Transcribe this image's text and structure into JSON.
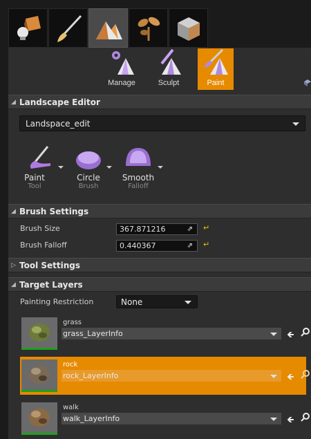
{
  "mode_tabs": [
    {
      "icon": "place-mode-icon"
    },
    {
      "icon": "paint-brush-mode-icon"
    },
    {
      "icon": "landscape-mode-icon"
    },
    {
      "icon": "foliage-mode-icon"
    },
    {
      "icon": "mesh-paint-mode-icon"
    }
  ],
  "tool_tabs": [
    {
      "label": "Manage",
      "icon": "manage-gear-icon"
    },
    {
      "label": "Sculpt",
      "icon": "sculpt-icon"
    },
    {
      "label": "Paint",
      "icon": "paint-icon"
    }
  ],
  "landscape_editor": {
    "header": "Landscape Editor",
    "selected_landscape": "Landspace_edit"
  },
  "tools": [
    {
      "label": "Paint",
      "sub": "Tool",
      "icon": "paint-tool-icon"
    },
    {
      "label": "Circle",
      "sub": "Brush",
      "icon": "circle-brush-icon"
    },
    {
      "label": "Smooth",
      "sub": "Falloff",
      "icon": "smooth-falloff-icon"
    }
  ],
  "brush_settings": {
    "header": "Brush Settings",
    "brush_size_label": "Brush Size",
    "brush_size_value": "367.871216",
    "brush_falloff_label": "Brush Falloff",
    "brush_falloff_value": "0.440367"
  },
  "tool_settings": {
    "header": "Tool Settings"
  },
  "target_layers": {
    "header": "Target Layers",
    "painting_restriction_label": "Painting Restriction",
    "painting_restriction_value": "None",
    "layers": [
      {
        "name": "grass",
        "info": "grass_LayerInfo",
        "selected": false
      },
      {
        "name": "rock",
        "info": "rock_LayerInfo",
        "selected": true
      },
      {
        "name": "walk",
        "info": "walk_LayerInfo",
        "selected": false
      }
    ]
  },
  "colors": {
    "accent_orange": "#e68a00",
    "panel": "#2e2e2e",
    "header": "#3b3b3b",
    "layer_underline_green": "#1fa11f",
    "reset_yellow": "#e6c200"
  }
}
